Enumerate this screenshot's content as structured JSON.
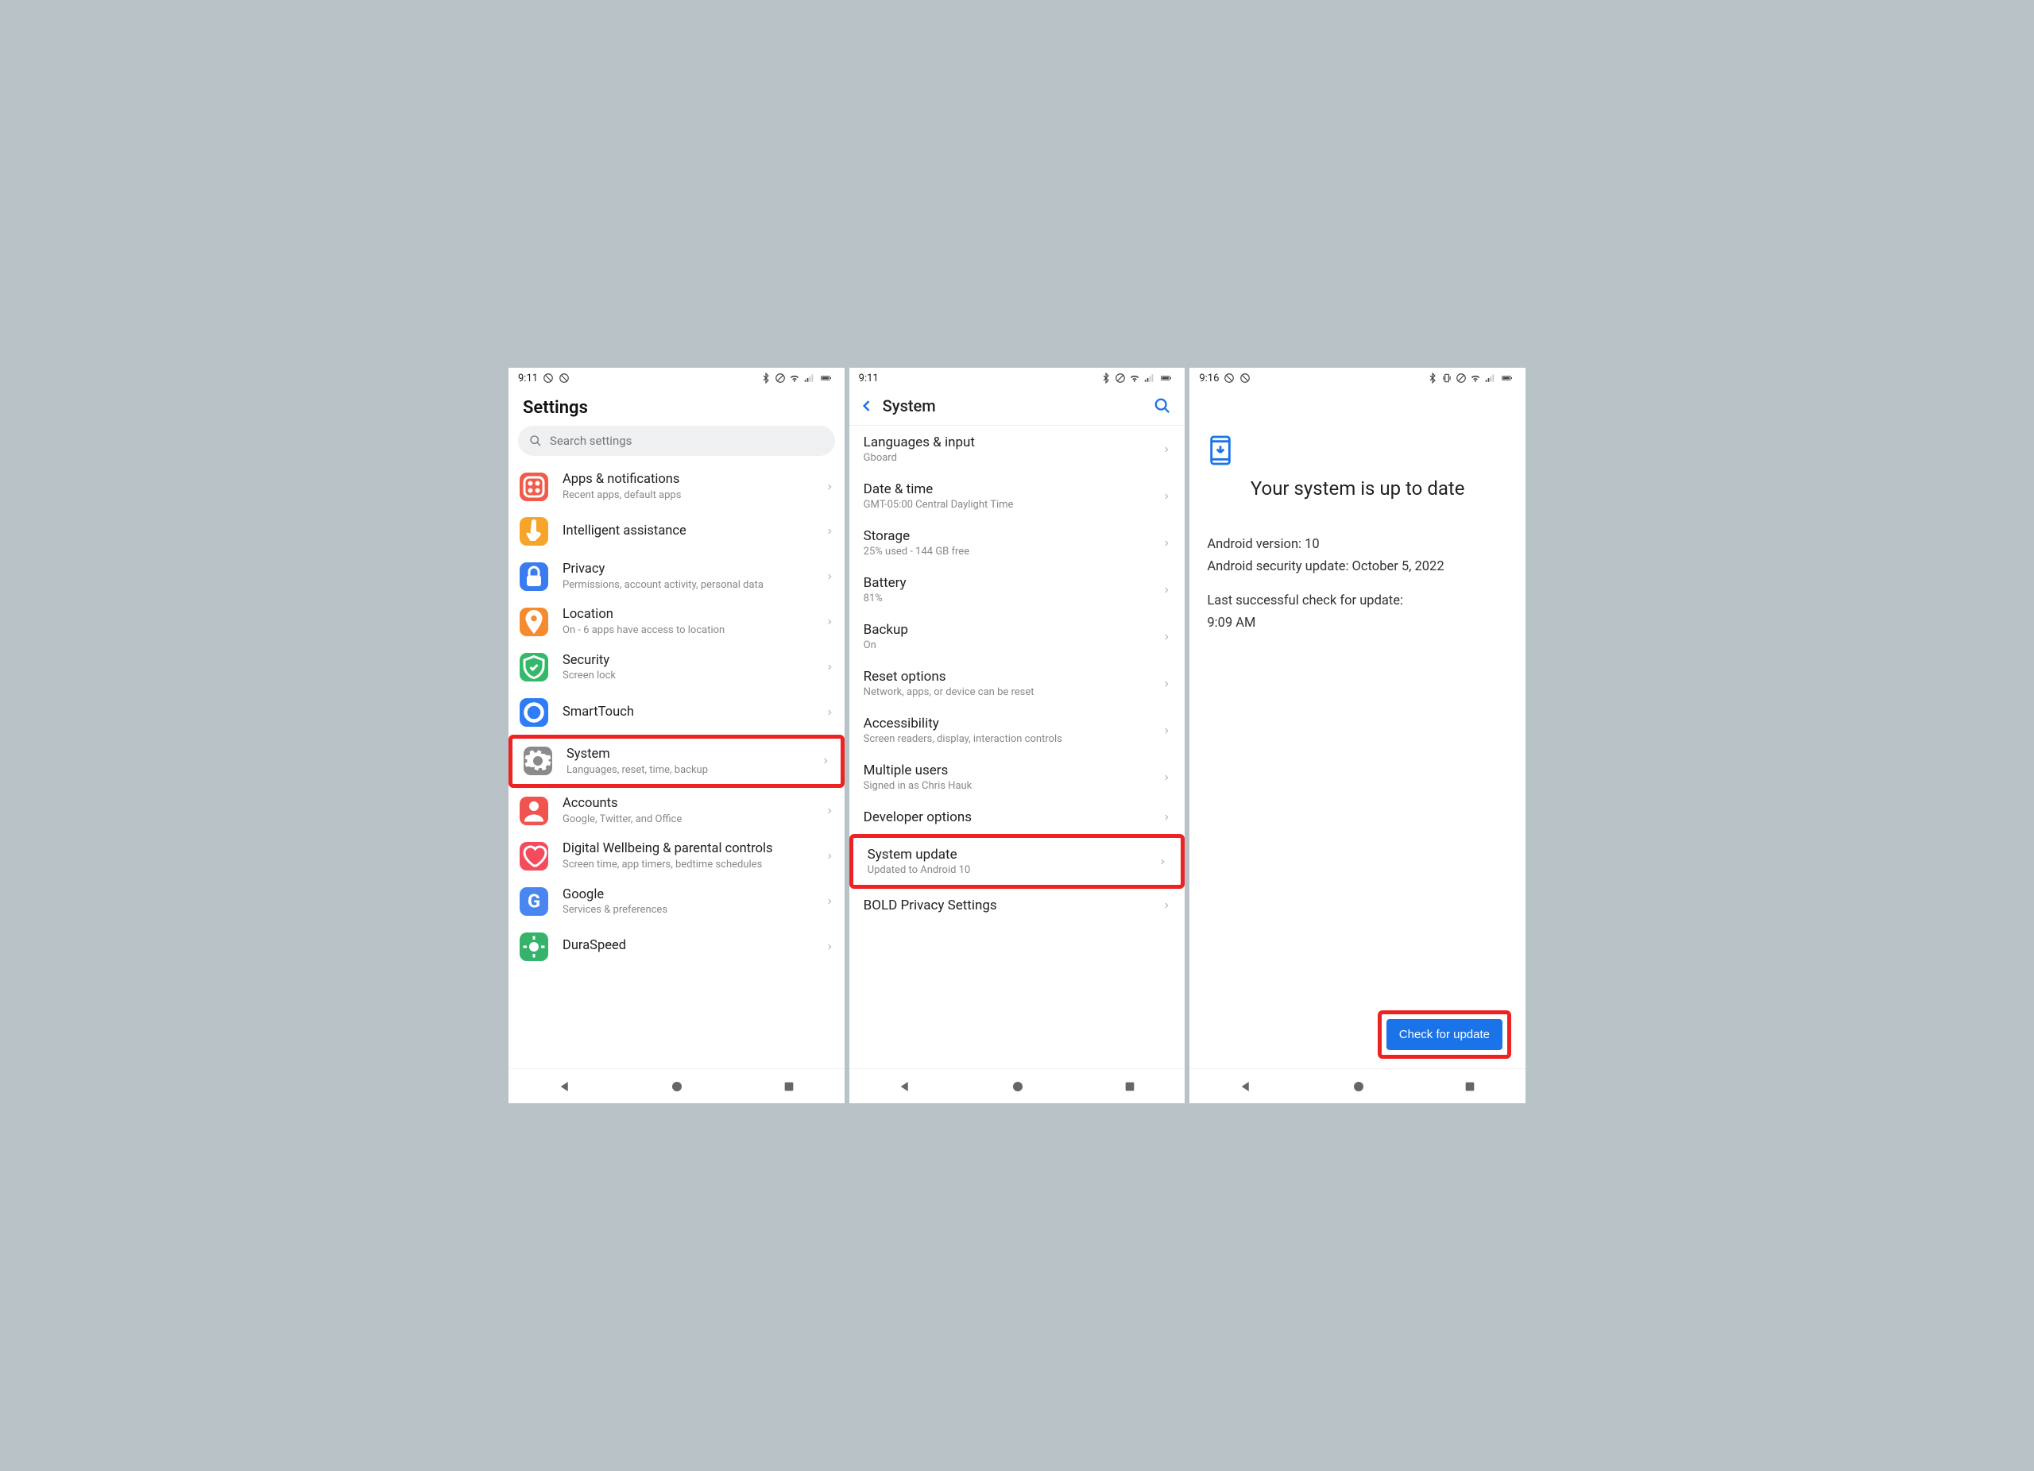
{
  "screen1": {
    "time": "9:11",
    "title": "Settings",
    "search_placeholder": "Search settings",
    "items": [
      {
        "title": "Apps & notifications",
        "sub": "Recent apps, default apps",
        "icon": "apps-icon",
        "bg": "bg-red"
      },
      {
        "title": "Intelligent assistance",
        "sub": "",
        "icon": "finger-icon",
        "bg": "bg-orange"
      },
      {
        "title": "Privacy",
        "sub": "Permissions, account activity, personal data",
        "icon": "lock-icon",
        "bg": "bg-blue"
      },
      {
        "title": "Location",
        "sub": "On - 6 apps have access to location",
        "icon": "location-icon",
        "bg": "bg-orange2"
      },
      {
        "title": "Security",
        "sub": "Screen lock",
        "icon": "shield-icon",
        "bg": "bg-green"
      },
      {
        "title": "SmartTouch",
        "sub": "",
        "icon": "circle-icon",
        "bg": "bg-cyan"
      },
      {
        "title": "System",
        "sub": "Languages, reset, time, backup",
        "icon": "gear-icon",
        "bg": "bg-grey",
        "highlight": true
      },
      {
        "title": "Accounts",
        "sub": "Google, Twitter, and Office",
        "icon": "person-icon",
        "bg": "bg-red2"
      },
      {
        "title": "Digital Wellbeing & parental controls",
        "sub": "Screen time, app timers, bedtime schedules",
        "icon": "heart-icon",
        "bg": "bg-pink"
      },
      {
        "title": "Google",
        "sub": "Services & preferences",
        "icon": "g-icon",
        "bg": "bg-gblue"
      },
      {
        "title": "DuraSpeed",
        "sub": "",
        "icon": "speed-icon",
        "bg": "bg-green2"
      }
    ]
  },
  "screen2": {
    "time": "9:11",
    "title": "System",
    "items": [
      {
        "title": "Languages & input",
        "sub": "Gboard"
      },
      {
        "title": "Date & time",
        "sub": "GMT-05:00 Central Daylight Time"
      },
      {
        "title": "Storage",
        "sub": "25% used - 144 GB free"
      },
      {
        "title": "Battery",
        "sub": "81%"
      },
      {
        "title": "Backup",
        "sub": "On"
      },
      {
        "title": "Reset options",
        "sub": "Network, apps, or device can be reset"
      },
      {
        "title": "Accessibility",
        "sub": "Screen readers, display, interaction controls"
      },
      {
        "title": "Multiple users",
        "sub": "Signed in as Chris Hauk"
      },
      {
        "title": "Developer options",
        "sub": ""
      },
      {
        "title": "System update",
        "sub": "Updated to Android 10",
        "highlight": true
      },
      {
        "title": "BOLD Privacy Settings",
        "sub": ""
      }
    ]
  },
  "screen3": {
    "time": "9:16",
    "headline": "Your system is up to date",
    "line1": "Android version: 10",
    "line2": "Android security update: October 5, 2022",
    "line3": "Last successful check for update:",
    "line4": "9:09 AM",
    "button": "Check for update"
  }
}
